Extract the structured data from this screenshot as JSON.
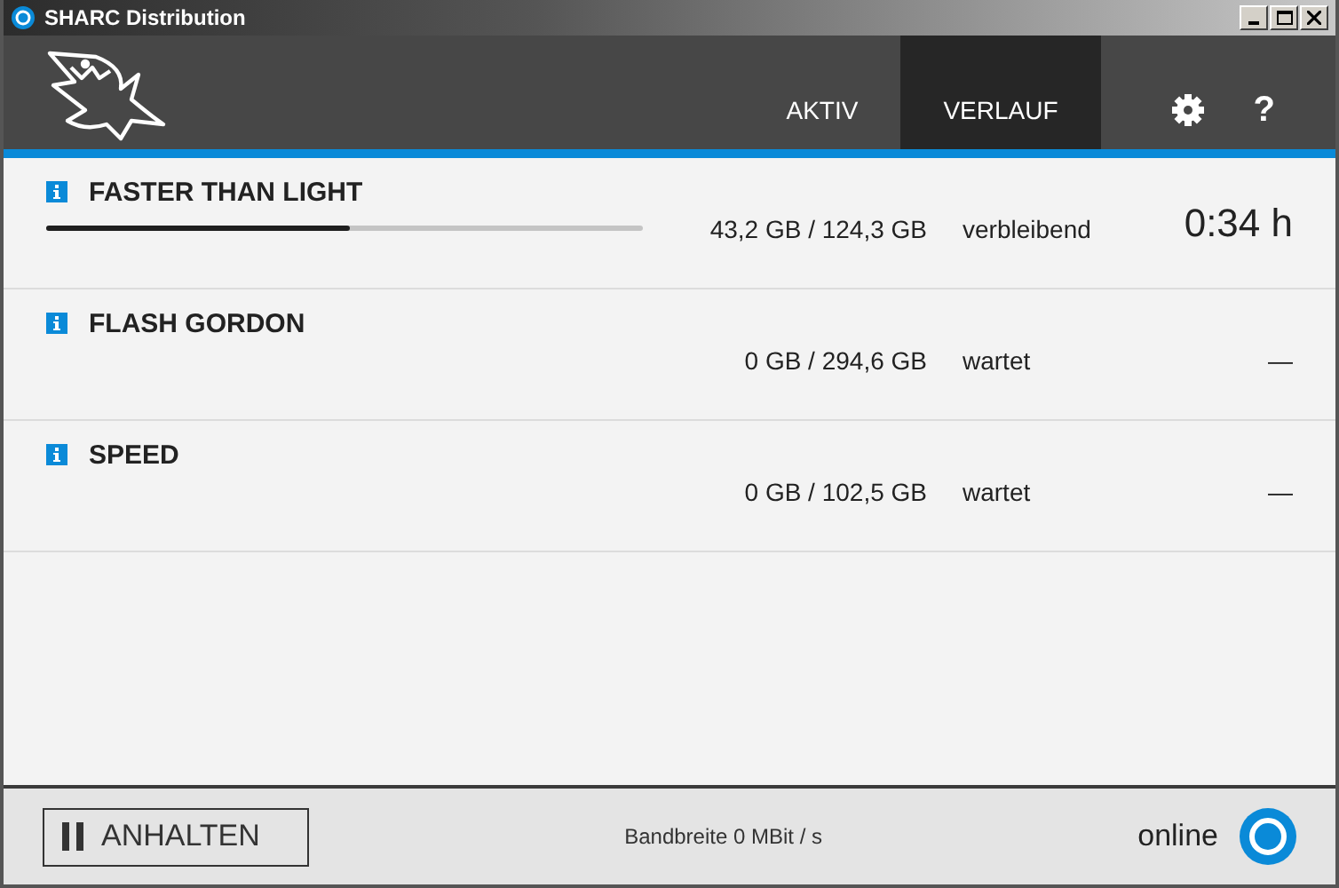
{
  "window": {
    "title": "SHARC Distribution"
  },
  "header": {
    "tabs": [
      {
        "label": "AKTIV",
        "selected": false
      },
      {
        "label": "VERLAUF",
        "selected": true
      }
    ],
    "help": "?"
  },
  "downloads": [
    {
      "title": "FASTER THAN LIGHT",
      "level": 0.51,
      "size": "43,2 GB / 124,3 GB",
      "status": "verbleibend",
      "remaining": "0:34 h",
      "kind": "active"
    },
    {
      "title": "FLASH GORDON",
      "size": "0 GB / 294,6 GB",
      "status": "wartet",
      "remaining": "—",
      "kind": "waiting"
    },
    {
      "title": "SPEED",
      "size": "0 GB / 102,5 GB",
      "status": "wartet",
      "remaining": "—",
      "kind": "waiting"
    }
  ],
  "footer": {
    "pause_button": "ANHALTEN",
    "bandwidth": "Bandbreite 0 MBit / s",
    "connection": "online"
  }
}
